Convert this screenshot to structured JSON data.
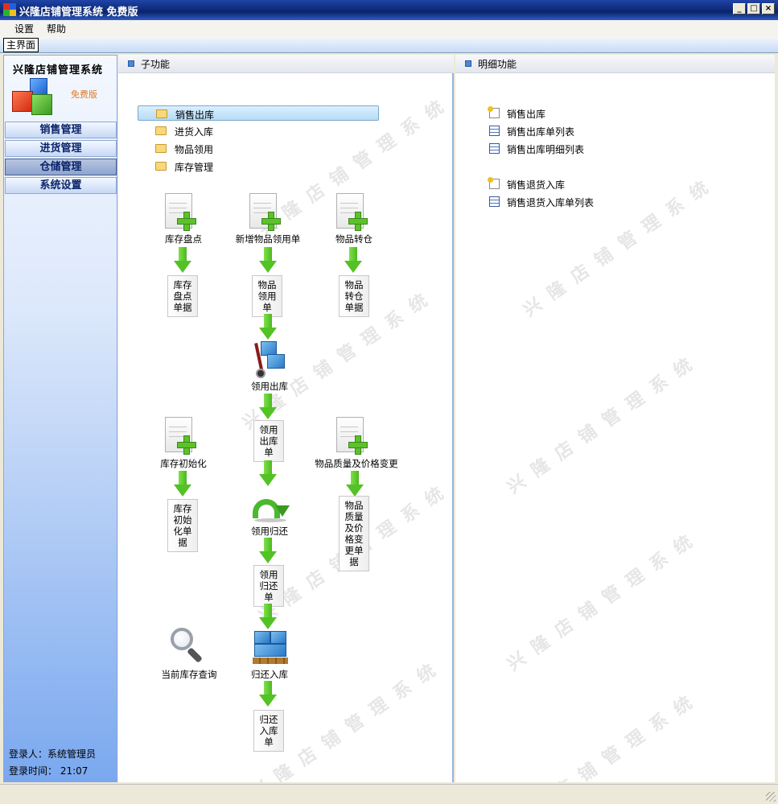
{
  "window": {
    "title": "兴隆店铺管理系统 免费版"
  },
  "menu": [
    "设置",
    "帮助"
  ],
  "tab": "主界面",
  "sidebar": {
    "brand": "兴隆店铺管理系统",
    "free_tag": "免费版",
    "nav": [
      "销售管理",
      "进货管理",
      "仓储管理",
      "系统设置"
    ],
    "active_nav": "仓储管理",
    "login_user": "登录人：系统管理员",
    "login_time": "登录时间： 21:07"
  },
  "middle": {
    "header": "子功能",
    "folders": [
      "销售出库",
      "进货入库",
      "物品领用",
      "库存管理"
    ],
    "selected_folder": "销售出库",
    "flow": {
      "inventory_check": "库存盘点",
      "inventory_check_doc": "库存盘点单据",
      "new_requisition": "新增物品领用单",
      "requisition_doc": "物品领用单",
      "transfer": "物品转仓",
      "transfer_doc": "物品转仓单据",
      "requisition_out": "领用出库",
      "requisition_out_doc": "领用出库单",
      "inventory_init": "库存初始化",
      "inventory_init_doc": "库存初始化单据",
      "quality_price_change": "物品质量及价格变更",
      "quality_price_doc": "物品质量及价格变更单据",
      "requisition_return": "领用归还",
      "requisition_return_doc": "领用归还单",
      "current_inventory_query": "当前库存查询",
      "return_in": "归还入库",
      "return_in_doc": "归还入库单"
    }
  },
  "right": {
    "header": "明细功能",
    "items": [
      {
        "label": "销售出库",
        "icon": "new-doc-icon"
      },
      {
        "label": "销售出库单列表",
        "icon": "table-icon"
      },
      {
        "label": "销售出库明细列表",
        "icon": "table-icon"
      },
      {
        "label": "销售退货入库",
        "icon": "new-doc-icon"
      },
      {
        "label": "销售退货入库单列表",
        "icon": "table-icon"
      }
    ]
  },
  "watermark": "兴隆店铺管理系统"
}
